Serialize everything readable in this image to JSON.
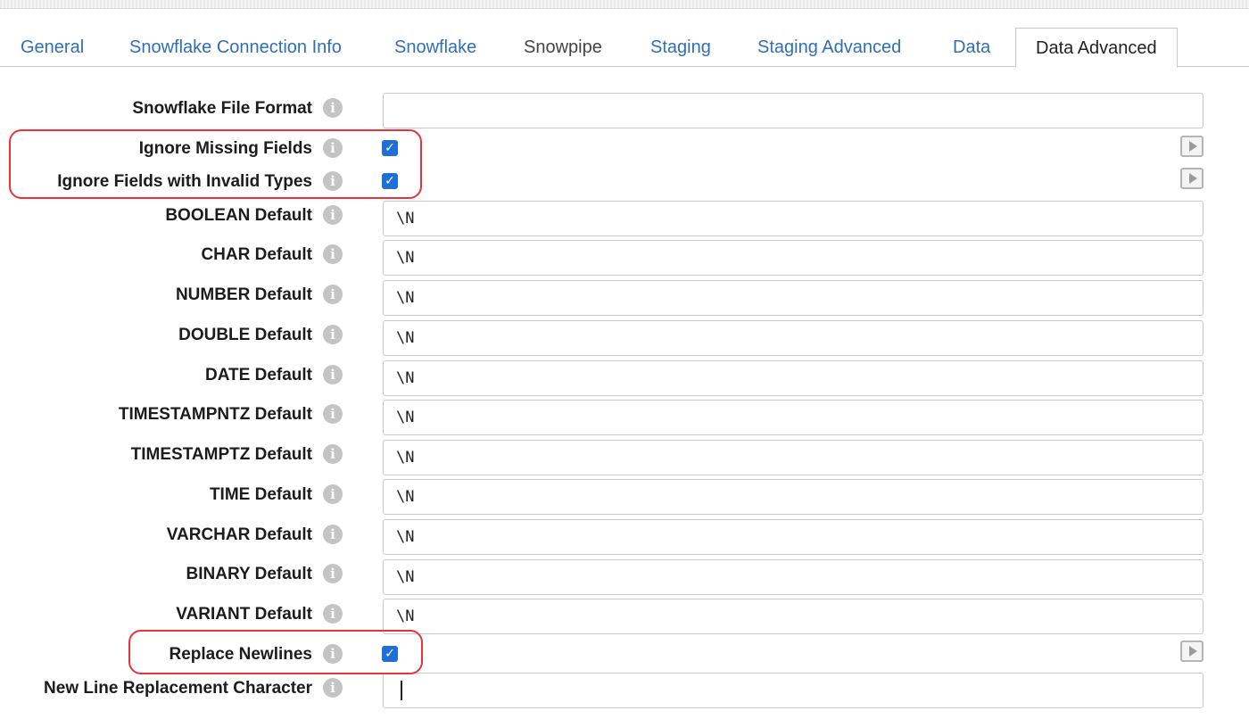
{
  "tabs": [
    {
      "label": "General"
    },
    {
      "label": "Snowflake Connection Info"
    },
    {
      "label": "Snowflake"
    },
    {
      "label": "Snowpipe"
    },
    {
      "label": "Staging"
    },
    {
      "label": "Staging Advanced"
    },
    {
      "label": "Data"
    },
    {
      "label": "Data Advanced"
    }
  ],
  "active_tab": "Data Advanced",
  "info_glyph": "i",
  "check_glyph": "✓",
  "fields": {
    "file_format": {
      "label": "Snowflake File Format",
      "value": ""
    },
    "ignore_missing": {
      "label": "Ignore Missing Fields",
      "checked": true
    },
    "ignore_invalid": {
      "label": "Ignore Fields with Invalid Types",
      "checked": true
    },
    "boolean_default": {
      "label": "BOOLEAN Default",
      "value": "\\N"
    },
    "char_default": {
      "label": "CHAR Default",
      "value": "\\N"
    },
    "number_default": {
      "label": "NUMBER Default",
      "value": "\\N"
    },
    "double_default": {
      "label": "DOUBLE Default",
      "value": "\\N"
    },
    "date_default": {
      "label": "DATE Default",
      "value": "\\N"
    },
    "timestampntz_default": {
      "label": "TIMESTAMPNTZ Default",
      "value": "\\N"
    },
    "timestamptz_default": {
      "label": "TIMESTAMPTZ Default",
      "value": "\\N"
    },
    "time_default": {
      "label": "TIME Default",
      "value": "\\N"
    },
    "varchar_default": {
      "label": "VARCHAR Default",
      "value": "\\N"
    },
    "binary_default": {
      "label": "BINARY Default",
      "value": "\\N"
    },
    "variant_default": {
      "label": "VARIANT Default",
      "value": "\\N"
    },
    "replace_newlines": {
      "label": "Replace Newlines",
      "checked": true
    },
    "newline_replacement": {
      "label": "New Line Replacement Character",
      "value": ""
    }
  },
  "colors": {
    "tab_link": "#2f6fb7",
    "checkbox": "#1f6fd6",
    "highlight": "#e8333d"
  }
}
